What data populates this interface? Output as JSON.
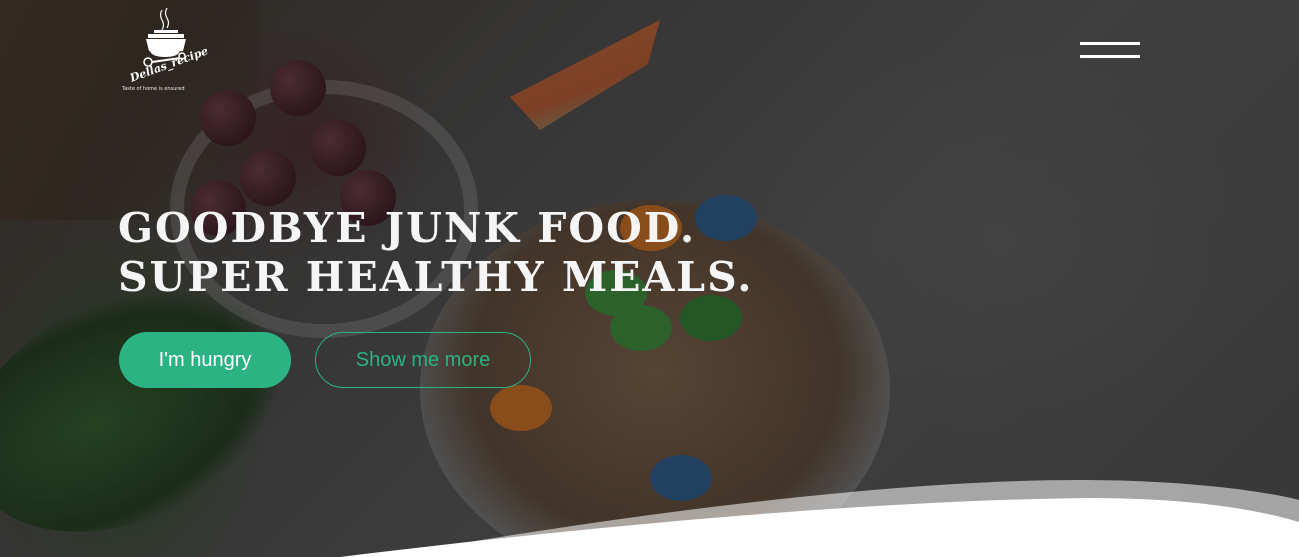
{
  "brand": {
    "name": "Dellas_recipe",
    "tagline": "Taste of home is ensured"
  },
  "hero": {
    "headline_line1": "GOODBYE JUNK FOOD.",
    "headline_line2": "SUPER HEALTHY MEALS.",
    "primary_button": "I'm hungry",
    "secondary_button": "Show me more"
  },
  "colors": {
    "accent": "#2bb384",
    "text": "#f5f5f5",
    "wave": "#ffffff"
  },
  "icons": {
    "menu": "hamburger-menu-icon",
    "logo": "cooking-pot-icon"
  }
}
